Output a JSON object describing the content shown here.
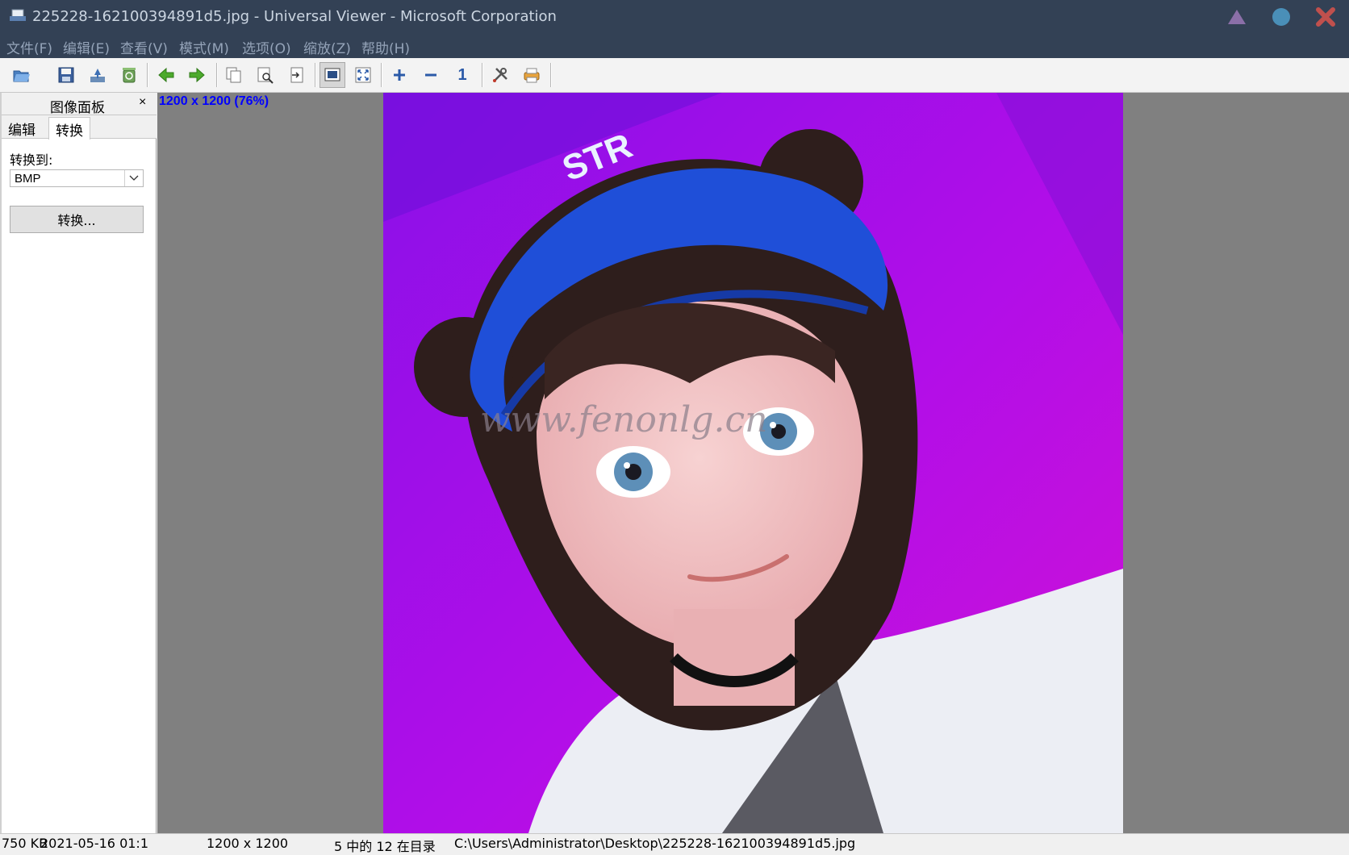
{
  "window": {
    "title": "225228-162100394891d5.jpg - Universal Viewer - Microsoft Corporation",
    "controls": {
      "minimize_color": "#8b6fa8",
      "maximize_color": "#4a8fb8",
      "close_color": "#c0504d"
    }
  },
  "menu": {
    "items": [
      "文件(F)",
      "编辑(E)",
      "查看(V)",
      "模式(M)",
      "选项(O)",
      "缩放(Z)",
      "帮助(H)"
    ]
  },
  "toolbar": {
    "buttons": [
      "open-icon",
      "save-icon",
      "export-icon",
      "recycle-icon",
      "prev-arrow-icon",
      "next-arrow-icon",
      "copy-icon",
      "find-icon",
      "goto-icon",
      "fit-window-icon",
      "fullscreen-icon",
      "zoom-in-icon",
      "zoom-out-icon",
      "actual-size-icon",
      "tools-icon",
      "print-icon"
    ],
    "zoom_one_label": "1"
  },
  "panel": {
    "title": "图像面板",
    "close": "×",
    "tabs": [
      "编辑",
      "转换"
    ],
    "active_tab": "转换",
    "convert_to_label": "转换到:",
    "format_value": "BMP",
    "convert_button": "转换..."
  },
  "viewer": {
    "image_info": "1200 x 1200 (76%)",
    "watermark": "www.fenonlg.cn",
    "cap_text": "STR",
    "background_color": "#808080",
    "artwork_colors": {
      "bg_top": "#9b12e6",
      "bg_bottom": "#c70fd6",
      "cap": "#1f4fd8",
      "hair": "#2e1e1c",
      "skin": "#f2c3c3"
    }
  },
  "status": {
    "size": "750 KB",
    "date": "2021-05-16 01:1",
    "dimensions": "1200 x 1200",
    "position": "5 中的 12 在目录",
    "path": "C:\\Users\\Administrator\\Desktop\\225228-162100394891d5.jpg"
  }
}
